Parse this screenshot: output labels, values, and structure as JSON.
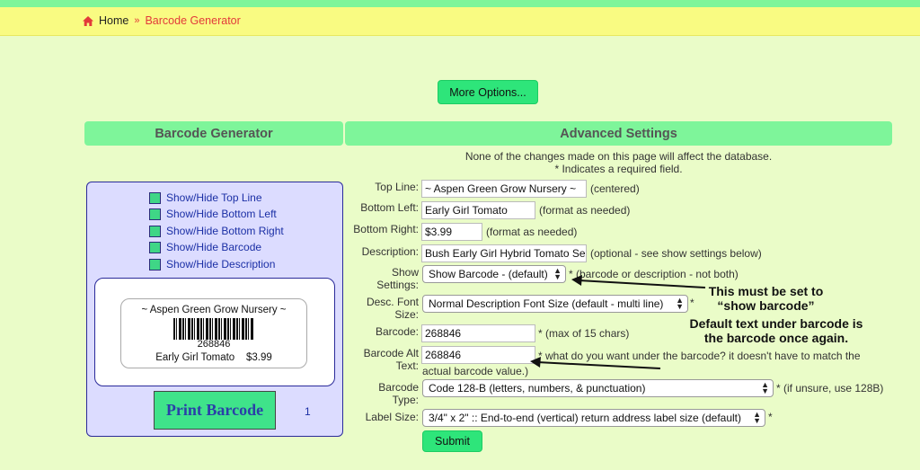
{
  "breadcrumb": {
    "home": "Home",
    "separator": "»",
    "current": "Barcode Generator"
  },
  "more_options": "More Options...",
  "left_header": "Barcode Generator",
  "right_header": "Advanced Settings",
  "notes": {
    "line1": "None of the changes made on this page will affect the database.",
    "line2": "* Indicates a required field."
  },
  "toggles": [
    "Show/Hide Top Line",
    "Show/Hide Bottom Left",
    "Show/Hide Bottom Right",
    "Show/Hide Barcode",
    "Show/Hide Description"
  ],
  "preview": {
    "top_line": "~ Aspen Green Grow Nursery ~",
    "barcode_text": "268846",
    "bottom_left": "Early Girl Tomato",
    "bottom_right": "$3.99"
  },
  "print_button": "Print Barcode",
  "print_count": "1",
  "fields": {
    "top_line": {
      "label": "Top Line:",
      "value": "~ Aspen Green Grow Nursery ~",
      "hint": "(centered)"
    },
    "bottom_left": {
      "label": "Bottom Left:",
      "value": "Early Girl Tomato",
      "hint": "(format as needed)"
    },
    "bottom_right": {
      "label": "Bottom Right:",
      "value": "$3.99",
      "hint": "(format as needed)"
    },
    "description": {
      "label": "Description:",
      "value": "Bush Early Girl Hybrid Tomato Se",
      "hint": "(optional - see show settings below)"
    },
    "show_settings": {
      "label1": "Show",
      "label2": "Settings:",
      "value": "Show Barcode - (default)",
      "hint": "* (barcode or description - not both)"
    },
    "desc_font": {
      "label1": "Desc. Font",
      "label2": "Size:",
      "value": "Normal Description Font Size (default - multi line)",
      "hint": "*"
    },
    "barcode": {
      "label": "Barcode:",
      "value": "268846",
      "hint": "* (max of 15 chars)"
    },
    "barcode_alt": {
      "label1": "Barcode Alt",
      "label2": "Text:",
      "value": "268846",
      "hint1": "* what do you want under the barcode? it doesn't have to match the",
      "hint2": "actual barcode value.)"
    },
    "barcode_type": {
      "label1": "Barcode",
      "label2": "Type:",
      "value": "Code 128-B (letters, numbers, & punctuation)",
      "hint": "* (if unsure, use 128B)"
    },
    "label_size": {
      "label": "Label Size:",
      "value": "3/4\" x 2\" :: End-to-end (vertical) return address label size (default)",
      "hint": "*"
    }
  },
  "submit": "Submit",
  "annotations": {
    "a1_line1": "This must be set to",
    "a1_line2": "“show barcode”",
    "a2_line1": "Default text under barcode is",
    "a2_line2": "the barcode once again."
  }
}
